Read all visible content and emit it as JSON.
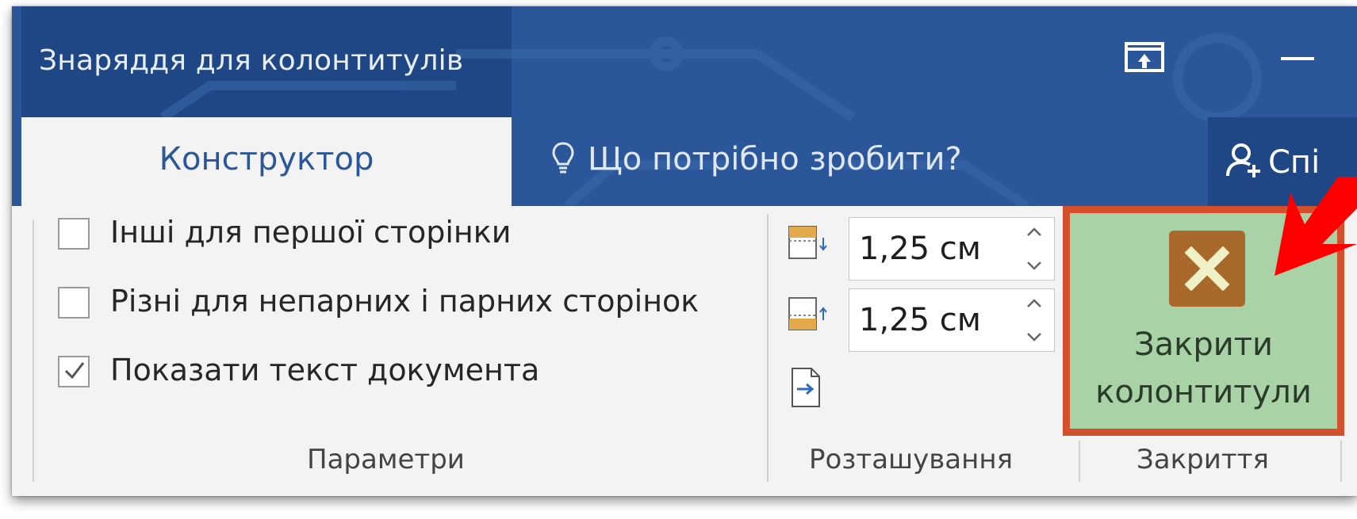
{
  "titlebar": {
    "tool_context": "Знаряддя для колонтитулів",
    "restore_icon": "ribbon-display-options-icon",
    "minimize_icon": "minimize-icon"
  },
  "tabs": {
    "active": "Конструктор",
    "tell_me": "Що потрібно зробити?",
    "share": "Спі"
  },
  "options_group": {
    "label": "Параметри",
    "checkboxes": [
      {
        "label": "Інші для першої сторінки",
        "checked": false
      },
      {
        "label": "Різні для непарних і парних сторінок",
        "checked": false
      },
      {
        "label": "Показати текст документа",
        "checked": true
      }
    ]
  },
  "position_group": {
    "label": "Розташування",
    "header_from_top": "1,25 см",
    "footer_from_bottom": "1,25 см",
    "insert_alignment_tab_icon": "insert-alignment-tab-icon"
  },
  "close_group": {
    "label": "Закриття",
    "button_line1": "Закрити",
    "button_line2": "колонтитули"
  },
  "colors": {
    "ribbon_blue": "#2b579a",
    "ribbon_dark": "#1f4785",
    "highlight_fill": "#a9d3a6",
    "highlight_border": "#d4502c",
    "arrow": "#ff0000"
  }
}
